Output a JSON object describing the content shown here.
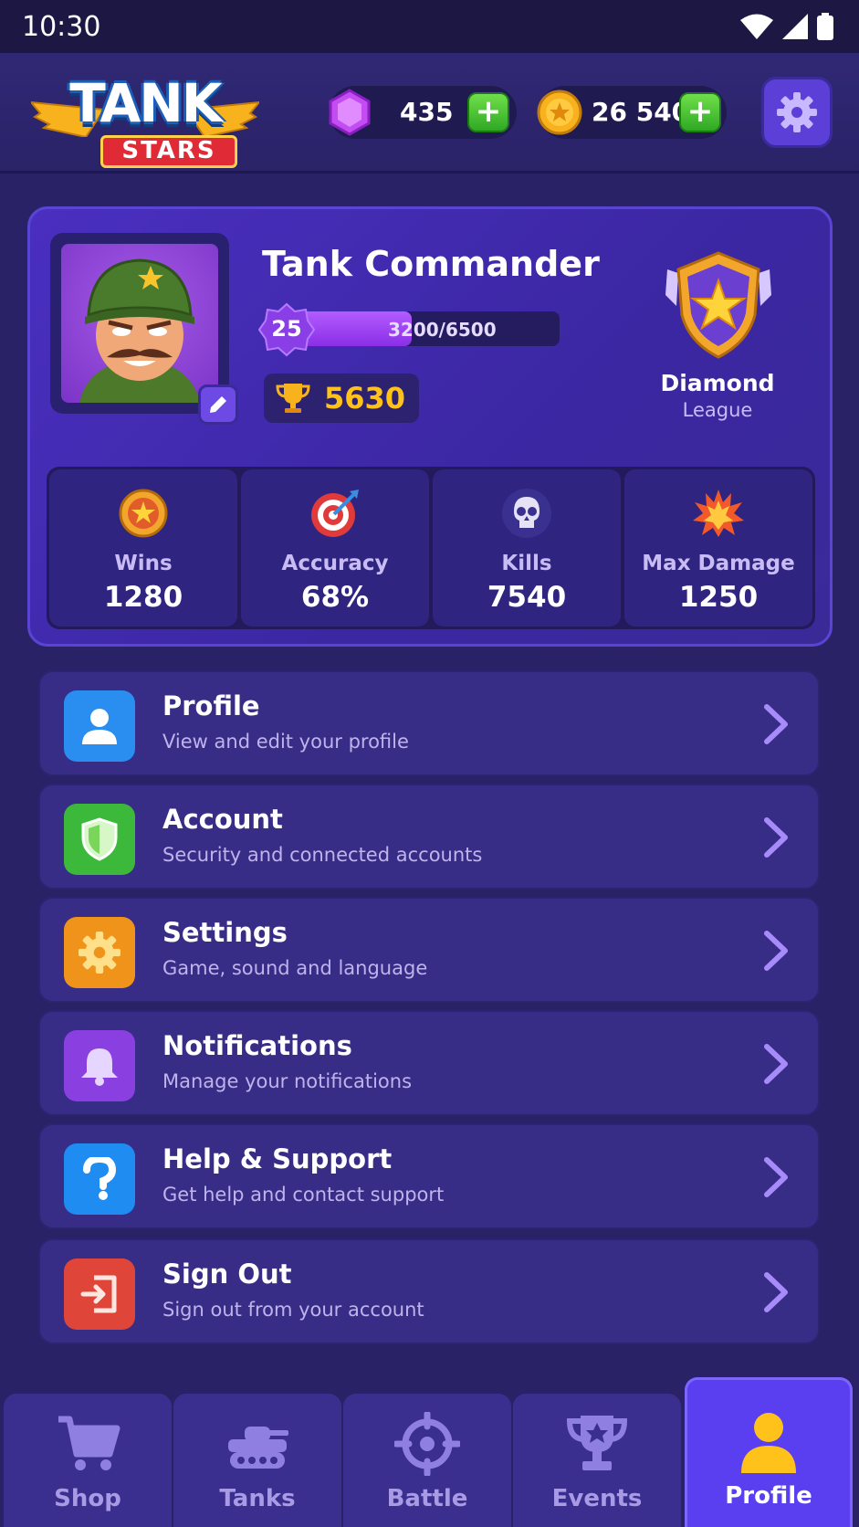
{
  "status_bar": {
    "time": "10:30"
  },
  "header": {
    "logo_title": "TANK",
    "logo_sub": "STARS",
    "gems": "435",
    "coins": "26 540",
    "plus_label": "+"
  },
  "profile": {
    "name": "Tank Commander",
    "level": "25",
    "xp_text": "3200/6500",
    "xp_progress": 0.492,
    "trophies": "5630",
    "league_name": "Diamond",
    "league_sub": "League"
  },
  "stats": [
    {
      "label": "Wins",
      "value": "1280",
      "icon": "medal-icon"
    },
    {
      "label": "Accuracy",
      "value": "68%",
      "icon": "target-icon"
    },
    {
      "label": "Kills",
      "value": "7540",
      "icon": "skull-icon"
    },
    {
      "label": "Max Damage",
      "value": "1250",
      "icon": "explosion-icon"
    }
  ],
  "menu": [
    {
      "title": "Profile",
      "sub": "View and edit your profile",
      "icon": "user-icon",
      "color": "#2a8df0"
    },
    {
      "title": "Account",
      "sub": "Security and connected accounts",
      "icon": "shield-icon",
      "color": "#3cb93a"
    },
    {
      "title": "Settings",
      "sub": "Game, sound and language",
      "icon": "gear-icon",
      "color": "#f0931a"
    },
    {
      "title": "Notifications",
      "sub": "Manage your notifications",
      "icon": "bell-icon",
      "color": "#8a3fe0"
    },
    {
      "title": "Help & Support",
      "sub": "Get help and contact support",
      "icon": "question-icon",
      "color": "#1e8cf0"
    },
    {
      "title": "Sign Out",
      "sub": "Sign out from your account",
      "icon": "sign-out-icon",
      "color": "#e0453a"
    }
  ],
  "nav": [
    {
      "label": "Shop",
      "icon": "cart-icon"
    },
    {
      "label": "Tanks",
      "icon": "tank-icon"
    },
    {
      "label": "Battle",
      "icon": "crosshair-icon"
    },
    {
      "label": "Events",
      "icon": "trophy-icon"
    },
    {
      "label": "Profile",
      "icon": "user-icon",
      "active": true
    }
  ]
}
